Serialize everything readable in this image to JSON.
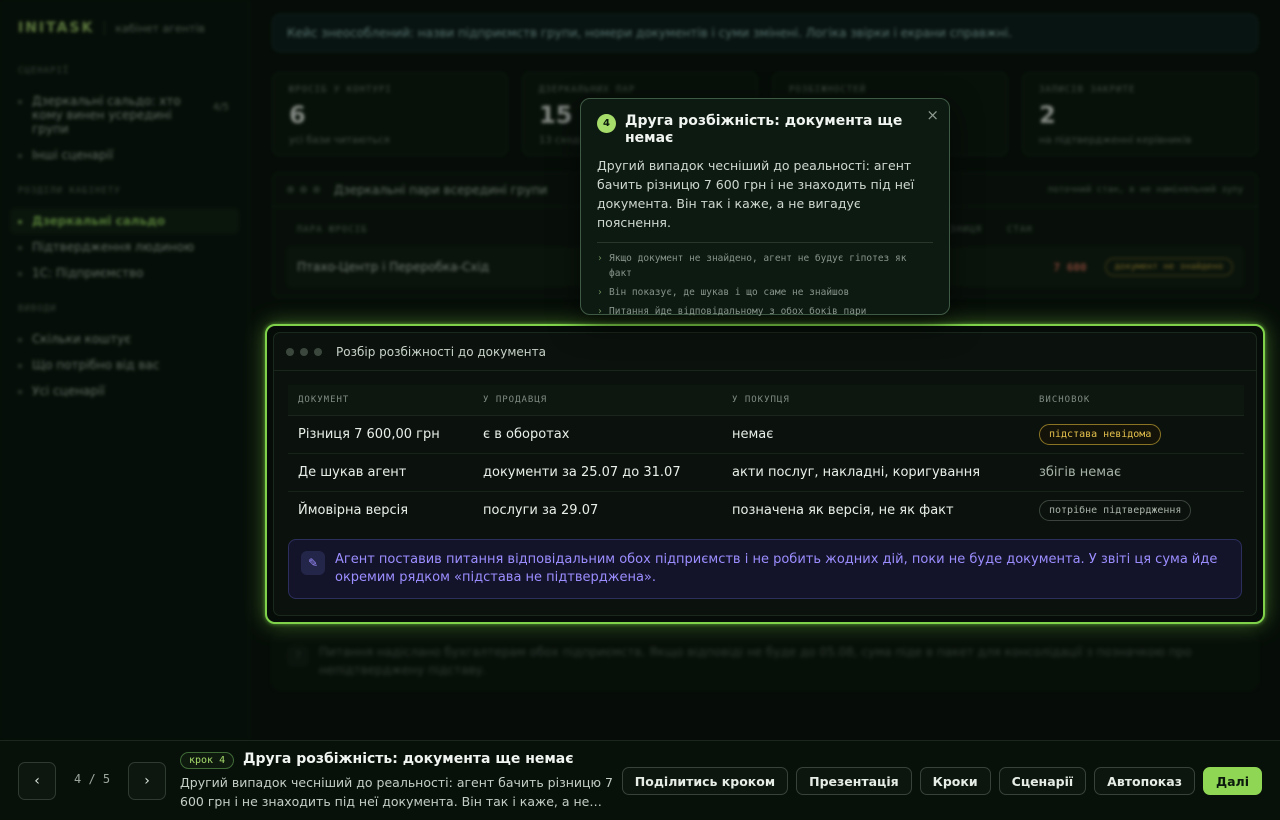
{
  "sidebar": {
    "brand": "INITASK",
    "subtitle": "кабінет агентів",
    "sections": [
      {
        "label": "СЦЕНАРІЇ",
        "items": [
          {
            "label": "Дзеркальні сальдо: хто кому винен усередині групи",
            "count": "4/5"
          },
          {
            "label": "Інші сценарії"
          }
        ]
      },
      {
        "label": "РОЗДІЛИ КАБІНЕТУ",
        "items": [
          {
            "label": "Дзеркальні сальдо",
            "active": true
          },
          {
            "label": "Підтвердження людиною"
          },
          {
            "label": "1С: Підприємство"
          }
        ]
      },
      {
        "label": "ВИВОДИ",
        "items": [
          {
            "label": "Скільки коштує"
          },
          {
            "label": "Що потрібно від вас"
          },
          {
            "label": "Усі сценарії"
          }
        ]
      }
    ]
  },
  "banner": "Кейс знеособлений: назви підприємств групи, номери документів і суми змінені. Логіка звірки і екрани справжні.",
  "stats": [
    {
      "label": "ЮРОСІБ У КОНТУРІ",
      "value": "6",
      "note": "усі бази читаються"
    },
    {
      "label": "ДЗЕРКАЛЬНИХ ПАР",
      "value": "15",
      "note": "13 сходяться"
    },
    {
      "label": "РОЗБІЖНОСТЕЙ",
      "value": "",
      "note": ""
    },
    {
      "label": "ЗАПИСІВ ЗАКРИТЕ",
      "value": "2",
      "note": "на підтвердженні керівників"
    }
  ],
  "bg_panel": {
    "title": "Дзеркальні пари всередині групи",
    "right_note": "поточний стан, в не наміняльний зупу",
    "headers": [
      "ПАРА ЮРОСІБ",
      "РІЗНИЦЯ",
      "СТАН"
    ],
    "row": {
      "pair": "Птахо-Центр і Переробка-Схід",
      "diff": "7 600",
      "status": "документ не знайдено"
    }
  },
  "focus_panel": {
    "title": "Розбір розбіжності до документа",
    "headers": [
      "ДОКУМЕНТ",
      "У ПРОДАВЦЯ",
      "У ПОКУПЦЯ",
      "ВИСНОВОК"
    ],
    "rows": [
      {
        "doc": "Різниця 7 600,00 грн",
        "seller": "є в оборотах",
        "buyer": "немає",
        "conclusion": "підстава невідома",
        "conclusion_type": "tag-amber"
      },
      {
        "doc": "Де шукав агент",
        "seller": "документи за 25.07 до 31.07",
        "buyer": "акти послуг, накладні, коригування",
        "conclusion": "збігів немає",
        "conclusion_type": "text"
      },
      {
        "doc": "Ймовірна версія",
        "seller": "послуги за 29.07",
        "buyer": "позначена як версія, не як факт",
        "conclusion": "потрібне підтвердження",
        "conclusion_type": "tag-gray"
      }
    ],
    "note": "Агент поставив питання відповідальним обох підприємств і не робить жодних дій, поки не буде документа. У звіті ця сума йде окремим рядком «підстава не підтверджена»."
  },
  "next_message": "Питання надіслано бухгалтерам обох підприємств. Якщо відповіді не буде до 05.08, сума піде в пакет для консолідації з позначкою про непідтверджену підставу.",
  "tooltip": {
    "step": "4",
    "title": "Друга розбіжність: документа ще немає",
    "body": "Другий випадок чесніший до реальності: агент бачить різницю 7 600 грн і не знаходить під неї документа. Він так і каже, а не вигадує пояснення.",
    "points": [
      "Якщо документ не знайдено, агент не будує гіпотез як факт",
      "Він показує, де шукав і що саме не знайшов",
      "Питання йде відповідальному з обох боків пари"
    ],
    "close": "×"
  },
  "bottombar": {
    "prev": "‹",
    "next": "›",
    "counter": "4 / 5",
    "step_badge": "крок 4",
    "title": "Друга розбіжність: документа ще немає",
    "desc": "Другий випадок чесніший до реальності: агент бачить різницю 7 600 грн і не знаходить під неї документа. Він так і каже, а не…",
    "actions": [
      "Поділитись кроком",
      "Презентація",
      "Кроки",
      "Сценарії",
      "Автопоказ"
    ],
    "primary": "Далі"
  }
}
